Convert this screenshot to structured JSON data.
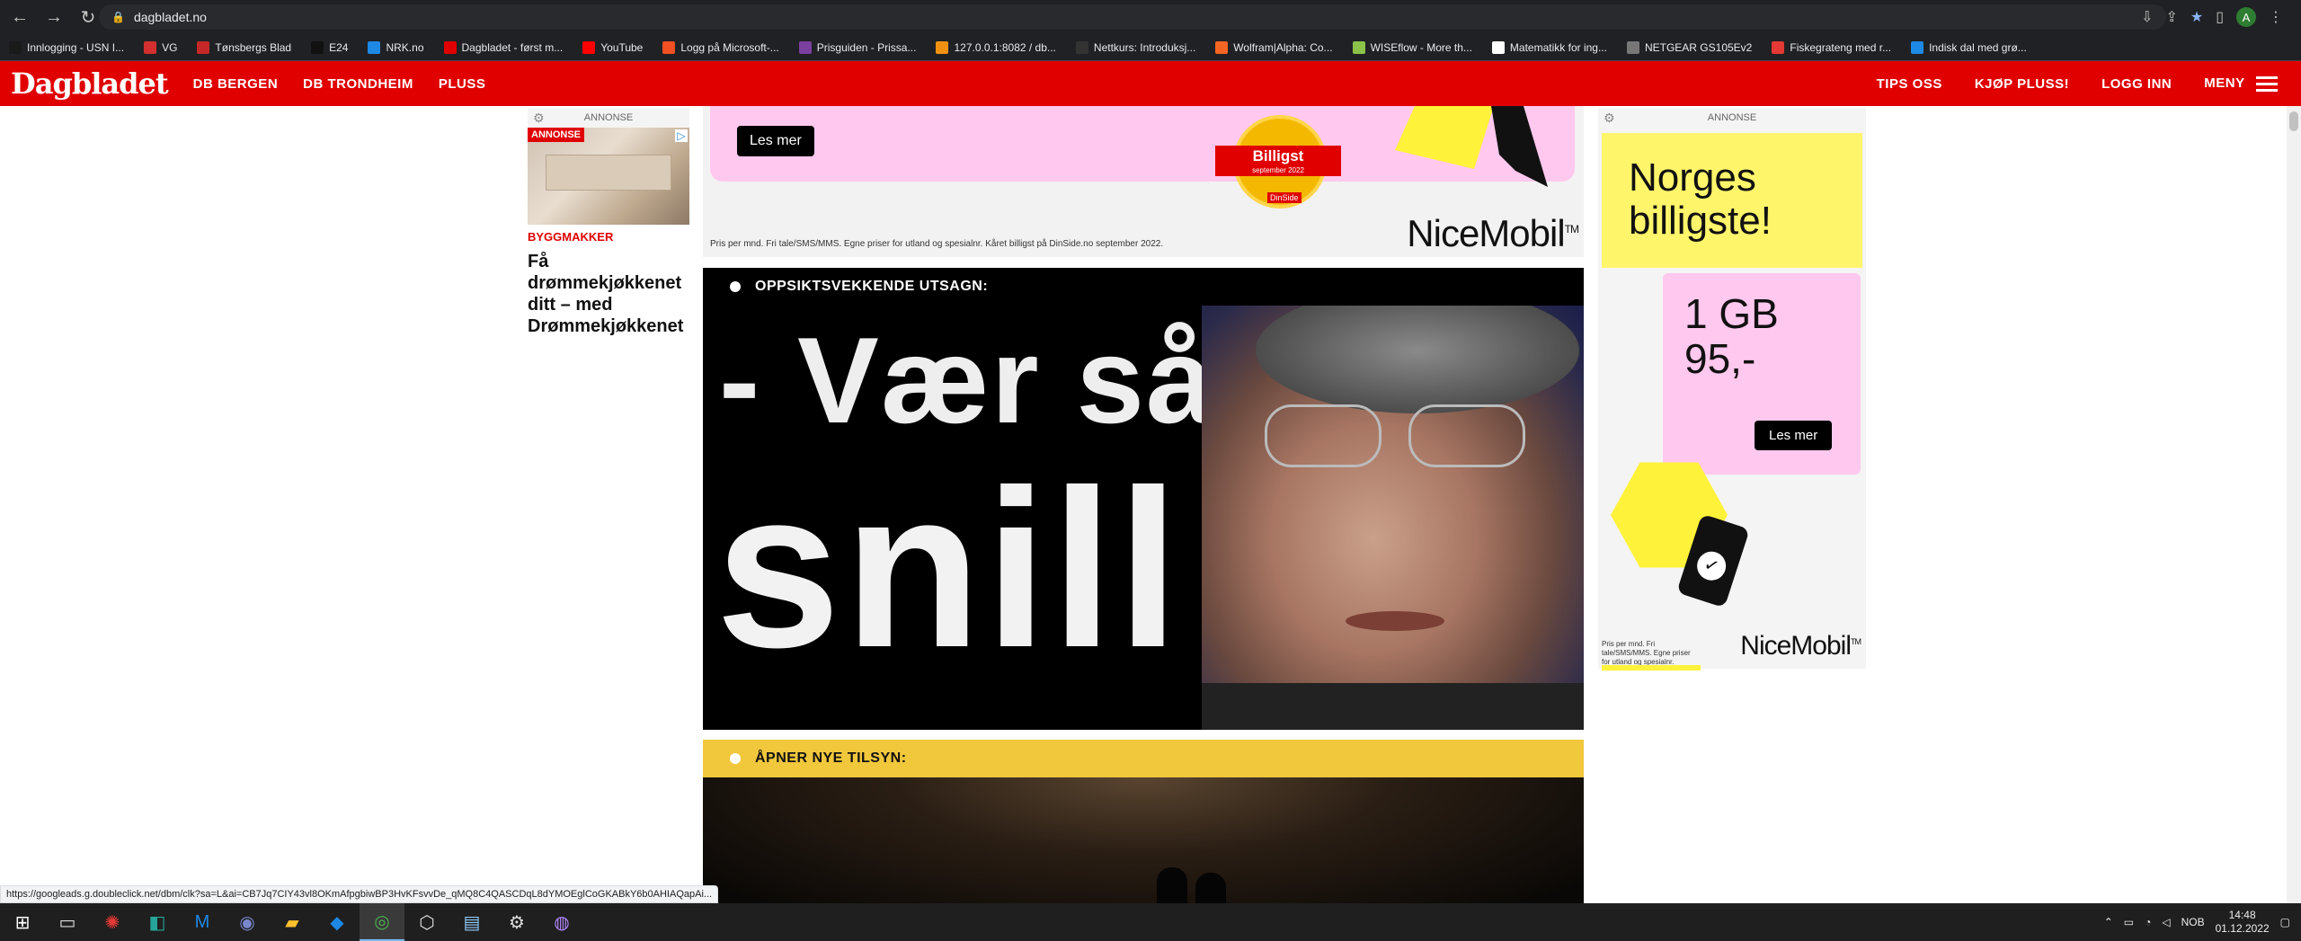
{
  "browser": {
    "url": "dagbladet.no",
    "profile_initial": "A",
    "bookmarks": [
      {
        "label": "Innlogging - USN I...",
        "color": "#1a1a1a"
      },
      {
        "label": "VG",
        "color": "#d32f2f"
      },
      {
        "label": "Tønsbergs Blad",
        "color": "#c62828"
      },
      {
        "label": "E24",
        "color": "#111111"
      },
      {
        "label": "NRK.no",
        "color": "#1e88e5"
      },
      {
        "label": "Dagbladet - først m...",
        "color": "#e00000"
      },
      {
        "label": "YouTube",
        "color": "#ff0000"
      },
      {
        "label": "Logg på Microsoft-...",
        "color": "#f25022"
      },
      {
        "label": "Prisguiden - Prissa...",
        "color": "#7b3fa0"
      },
      {
        "label": "127.0.0.1:8082 / db...",
        "color": "#f29111"
      },
      {
        "label": "Nettkurs: Introduksj...",
        "color": "#333333"
      },
      {
        "label": "Wolfram|Alpha: Co...",
        "color": "#f26522"
      },
      {
        "label": "WISEflow - More th...",
        "color": "#8bc34a"
      },
      {
        "label": "Matematikk for ing...",
        "color": "#ffffff"
      },
      {
        "label": "NETGEAR GS105Ev2",
        "color": "#777777"
      },
      {
        "label": "Fiskegrateng med r...",
        "color": "#e53935"
      },
      {
        "label": "Indisk dal med grø...",
        "color": "#1e88e5"
      }
    ]
  },
  "site_nav": {
    "logo": "Dagbladet",
    "links": [
      "DB BERGEN",
      "DB TRONDHEIM",
      "PLUSS"
    ],
    "right_links": [
      "TIPS OSS",
      "KJØP PLUSS!",
      "LOGG INN"
    ],
    "menu_label": "MENY"
  },
  "left_ad": {
    "label": "ANNONSE",
    "tag": "ANNONSE",
    "category": "BYGGMAKKER",
    "title": "Få drømmekjøkkenet ditt – med Drømmekjøkkenet"
  },
  "top_ad": {
    "button": "Les mer",
    "badge": "Billigst",
    "badge_sub": "september 2022",
    "badge_logo": "DinSide",
    "fine_print": "Pris per mnd. Fri tale/SMS/MMS. Egne priser for utland og spesialnr. Kåret billigst på DinSide.no september 2022.",
    "brand": "NiceMobil",
    "brand_tm": "TM"
  },
  "article1": {
    "label": "OPPSIKTSVEKKENDE UTSAGN:",
    "headline_line1": "- Vær så",
    "headline_line2": "snill"
  },
  "article2": {
    "label": "ÅPNER NYE TILSYN:"
  },
  "right_ad": {
    "label": "ANNONSE",
    "headline": "Norges billigste!",
    "price_line1": "1 GB",
    "price_line2": "95,-",
    "button": "Les mer",
    "fine_print": "Pris per mnd. Fri tale/SMS/MMS. Egne priser for utland og spesialnr.",
    "brand": "NiceMobil",
    "brand_tm": "TM"
  },
  "status_url": "https://googleads.g.doubleclick.net/dbm/clk?sa=L&ai=CB7Jq7CIY43vl8OKmAfpgbiwBP3HvKFsvvDe_qMQ8C4QASCDqL8dYMOEglCoGKABkY6b0AHIAQapAi...",
  "taskbar": {
    "lang": "NOB",
    "time": "14:48",
    "date": "01.12.2022"
  }
}
